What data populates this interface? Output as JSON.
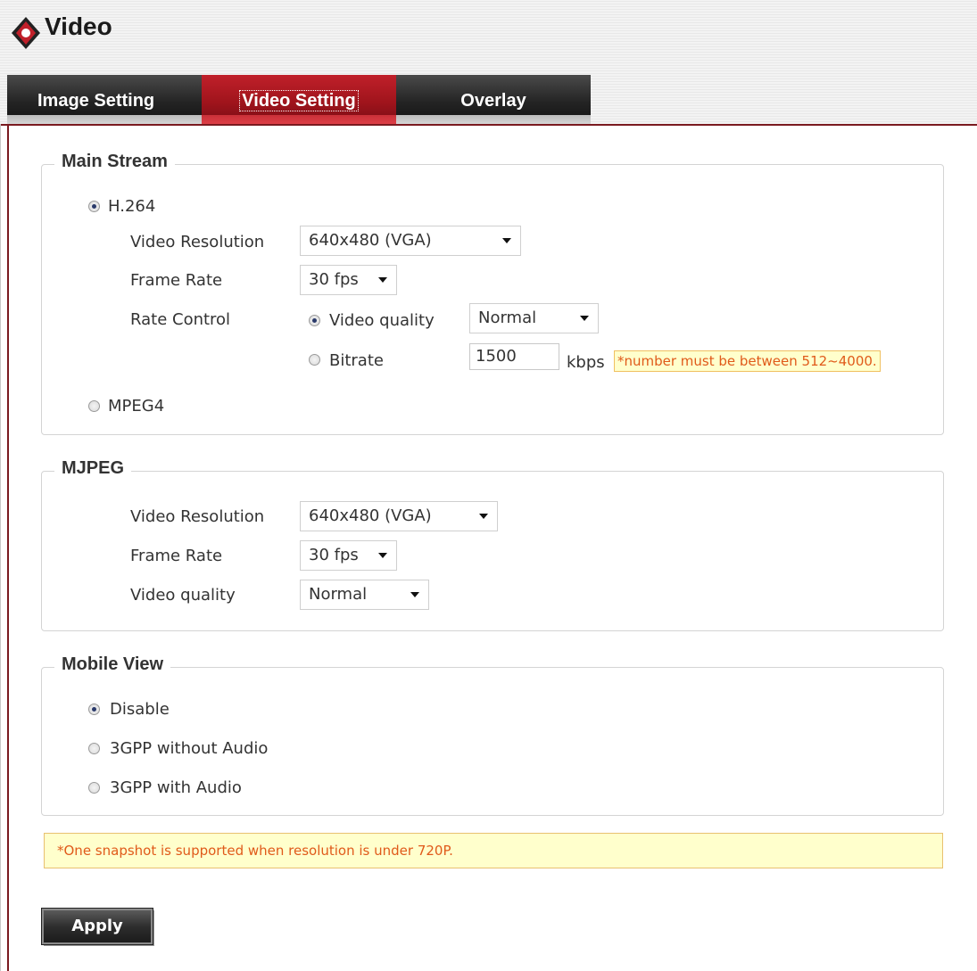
{
  "header": {
    "title": "Video",
    "logo_icon": "camera-logo-icon",
    "tabs": [
      {
        "label": "Image Setting",
        "active": false
      },
      {
        "label": "Video Setting",
        "active": true
      },
      {
        "label": "Overlay",
        "active": false
      }
    ]
  },
  "main_stream": {
    "legend": "Main Stream",
    "h264_label": "H.264",
    "h264_selected": true,
    "video_resolution_label": "Video Resolution",
    "video_resolution_value": "640x480 (VGA)",
    "frame_rate_label": "Frame Rate",
    "frame_rate_value": "30 fps",
    "rate_control_label": "Rate Control",
    "video_quality_label": "Video quality",
    "video_quality_selected": true,
    "video_quality_value": "Normal",
    "bitrate_label": "Bitrate",
    "bitrate_selected": false,
    "bitrate_value": "1500",
    "bitrate_unit": "kbps",
    "bitrate_hint": "*number must be between 512~4000.",
    "mpeg4_label": "MPEG4",
    "mpeg4_selected": false
  },
  "mjpeg": {
    "legend": "MJPEG",
    "video_resolution_label": "Video Resolution",
    "video_resolution_value": "640x480 (VGA)",
    "frame_rate_label": "Frame Rate",
    "frame_rate_value": "30 fps",
    "video_quality_label": "Video quality",
    "video_quality_value": "Normal"
  },
  "mobile_view": {
    "legend": "Mobile View",
    "options": [
      {
        "label": "Disable",
        "selected": true
      },
      {
        "label": "3GPP without Audio",
        "selected": false
      },
      {
        "label": "3GPP with Audio",
        "selected": false
      }
    ]
  },
  "note": "*One snapshot is supported when resolution is under 720P.",
  "apply_label": "Apply",
  "colors": {
    "active_tab": "#a0141c",
    "frame": "#7a1a20",
    "hint_text": "#e05a1a",
    "hint_bg": "#ffffcc"
  }
}
